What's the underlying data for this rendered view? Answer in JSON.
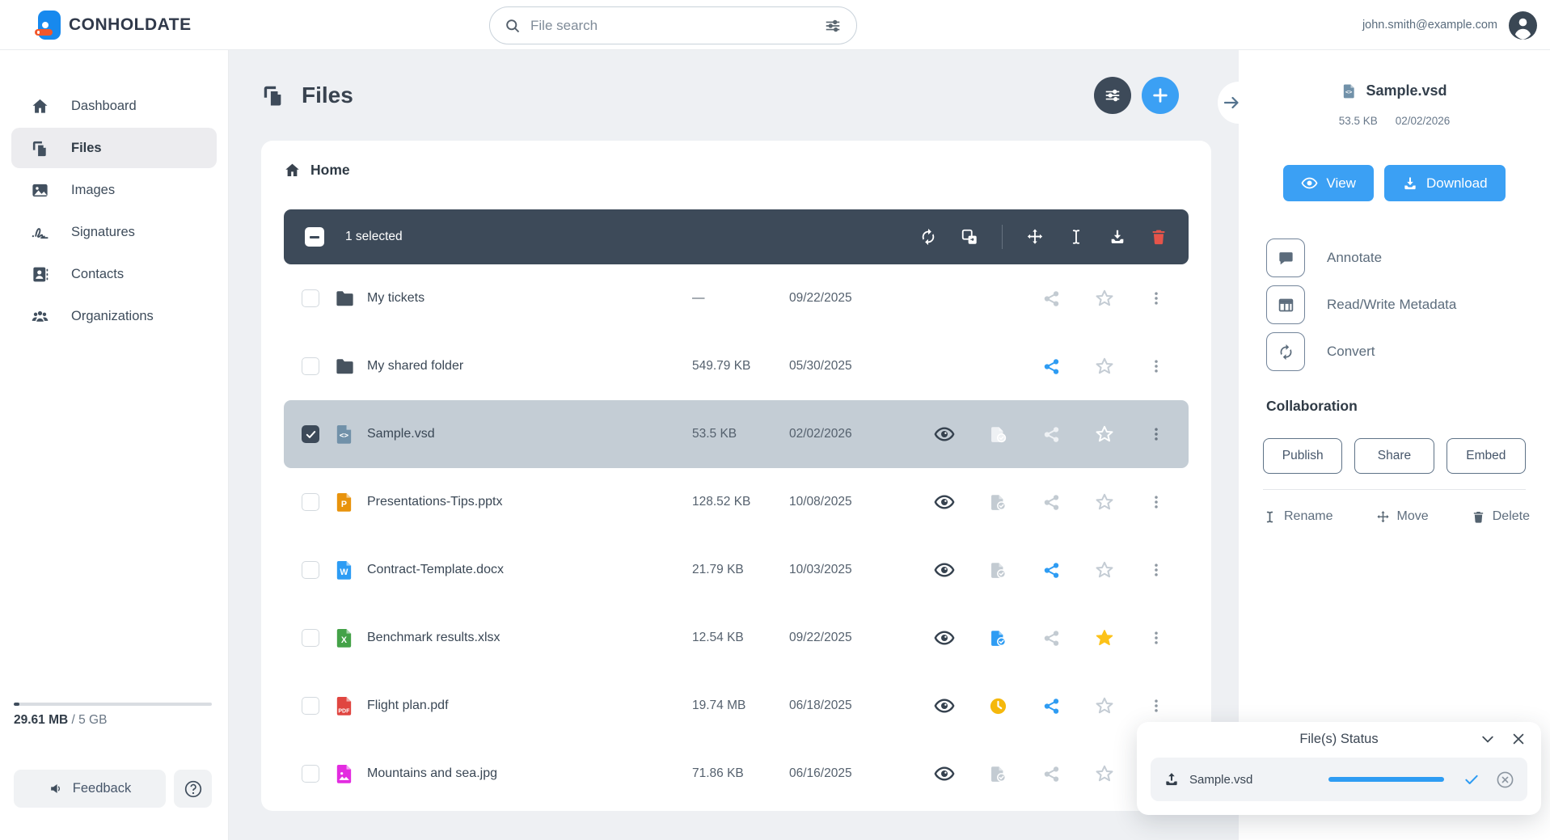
{
  "header": {
    "brand": "CONHOLDATE",
    "search_placeholder": "File search",
    "user_email": "john.smith@example.com"
  },
  "sidebar": {
    "items": [
      {
        "label": "Dashboard",
        "icon": "home-icon",
        "active": false
      },
      {
        "label": "Files",
        "icon": "files-icon",
        "active": true
      },
      {
        "label": "Images",
        "icon": "image-icon",
        "active": false
      },
      {
        "label": "Signatures",
        "icon": "signature-icon",
        "active": false
      },
      {
        "label": "Contacts",
        "icon": "contacts-icon",
        "active": false
      },
      {
        "label": "Organizations",
        "icon": "organizations-icon",
        "active": false
      }
    ],
    "storage_used": "29.61 MB",
    "storage_total": " / 5 GB",
    "storage_percent": 3,
    "feedback_label": "Feedback"
  },
  "main": {
    "title": "Files",
    "breadcrumb": "Home",
    "toolbar": {
      "selected_text": "1 selected"
    },
    "files": [
      {
        "name": "My tickets",
        "type": "folder",
        "size": "—",
        "date": "09/22/2025",
        "eye": false,
        "doc": "none",
        "share": "gray",
        "star": "outline",
        "selected": false
      },
      {
        "name": "My shared folder",
        "type": "folder",
        "size": "549.79 KB",
        "date": "05/30/2025",
        "eye": false,
        "doc": "none",
        "share": "blue",
        "star": "outline",
        "selected": false
      },
      {
        "name": "Sample.vsd",
        "type": "vsd",
        "size": "53.5 KB",
        "date": "02/02/2026",
        "eye": true,
        "doc": "gray",
        "share": "gray",
        "star": "outline",
        "selected": true
      },
      {
        "name": "Presentations-Tips.pptx",
        "type": "pptx",
        "size": "128.52 KB",
        "date": "10/08/2025",
        "eye": true,
        "doc": "gray",
        "share": "gray",
        "star": "outline",
        "selected": false
      },
      {
        "name": "Contract-Template.docx",
        "type": "docx",
        "size": "21.79 KB",
        "date": "10/03/2025",
        "eye": true,
        "doc": "gray",
        "share": "blue",
        "star": "outline",
        "selected": false
      },
      {
        "name": "Benchmark results.xlsx",
        "type": "xlsx",
        "size": "12.54 KB",
        "date": "09/22/2025",
        "eye": true,
        "doc": "blue",
        "share": "gray",
        "star": "filled",
        "selected": false
      },
      {
        "name": "Flight plan.pdf",
        "type": "pdf",
        "size": "19.74 MB",
        "date": "06/18/2025",
        "eye": true,
        "doc": "clock",
        "share": "blue",
        "star": "outline",
        "selected": false
      },
      {
        "name": "Mountains and sea.jpg",
        "type": "jpg",
        "size": "71.86 KB",
        "date": "06/16/2025",
        "eye": true,
        "doc": "gray",
        "share": "gray",
        "star": "outline",
        "selected": false
      }
    ]
  },
  "details": {
    "file_name": "Sample.vsd",
    "file_size": "53.5 KB",
    "file_date": "02/02/2026",
    "view_label": "View",
    "download_label": "Download",
    "actions": [
      {
        "label": "Annotate",
        "icon": "annotate-icon"
      },
      {
        "label": "Read/Write Metadata",
        "icon": "metadata-icon"
      },
      {
        "label": "Convert",
        "icon": "convert-icon"
      }
    ],
    "collaboration_title": "Collaboration",
    "collab_buttons": [
      {
        "label": "Publish"
      },
      {
        "label": "Share"
      },
      {
        "label": "Embed"
      }
    ],
    "ops": [
      {
        "label": "Rename",
        "icon": "rename-icon"
      },
      {
        "label": "Move",
        "icon": "move-icon"
      },
      {
        "label": "Delete",
        "icon": "delete-icon"
      }
    ]
  },
  "status_panel": {
    "title": "File(s) Status",
    "item_name": "Sample.vsd",
    "progress_percent": 100
  },
  "colors": {
    "accent_blue": "#3ba0f4",
    "share_blue": "#2e9cf3",
    "dark_slate": "#3d4a59",
    "danger_red": "#e6544a",
    "clock_yellow": "#f5b80c",
    "star_yellow": "#fcc219",
    "selected_row": "#c4cdd5",
    "filetypes": {
      "folder": "#47535f",
      "vsd": "#7191a9",
      "pptx": "#e8930c",
      "docx": "#2d9cf4",
      "xlsx": "#44a248",
      "pdf": "#e04540",
      "jpg": "#e32ce0"
    }
  }
}
